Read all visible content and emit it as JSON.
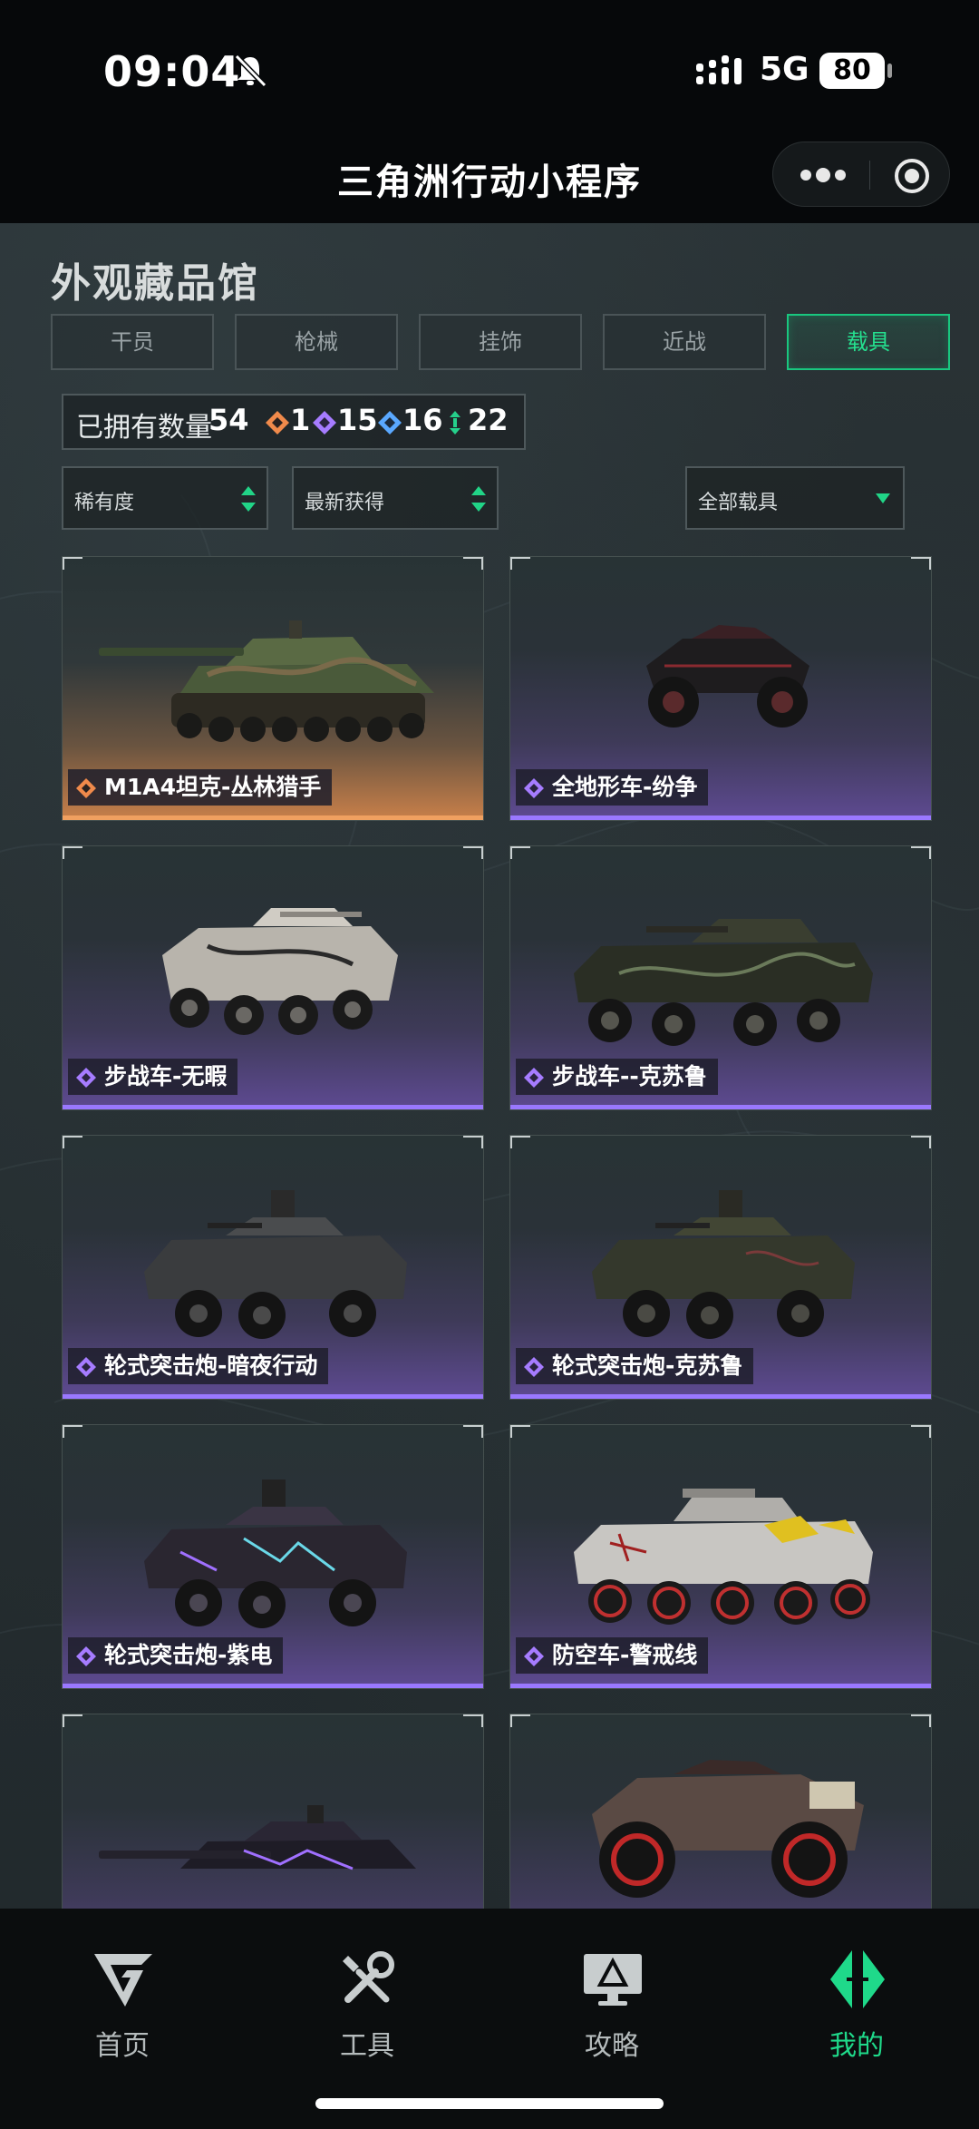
{
  "status_bar": {
    "time": "09:04",
    "network": "5G",
    "battery": "80"
  },
  "title_bar": {
    "title": "三角洲行动小程序"
  },
  "header": {
    "section_title": "外观藏品馆"
  },
  "tabs": [
    {
      "label": "干员",
      "active": false
    },
    {
      "label": "枪械",
      "active": false
    },
    {
      "label": "挂饰",
      "active": false
    },
    {
      "label": "近战",
      "active": false
    },
    {
      "label": "载具",
      "active": true
    }
  ],
  "owned": {
    "label": "已拥有数量",
    "count": "54",
    "stats": [
      {
        "value": "1",
        "color": "#f08a4b",
        "icon": "orange-diamond-icon"
      },
      {
        "value": "15",
        "color": "#a67cff",
        "icon": "purple-diamond-icon"
      },
      {
        "value": "16",
        "color": "#5aa8ff",
        "icon": "blue-diamond-icon"
      },
      {
        "value": "22",
        "color": "#25d08b",
        "icon": "green-diamond-icon"
      }
    ]
  },
  "filters": {
    "rarity": "稀有度",
    "sort": "最新获得",
    "category": "全部载具"
  },
  "cards": [
    {
      "name": "M1A4坦克-丛林猎手",
      "rarity": "orange"
    },
    {
      "name": "全地形车-纷争",
      "rarity": "purple"
    },
    {
      "name": "步战车-无暇",
      "rarity": "purple"
    },
    {
      "name": "步战车--克苏鲁",
      "rarity": "purple"
    },
    {
      "name": "轮式突击炮-暗夜行动",
      "rarity": "purple"
    },
    {
      "name": "轮式突击炮-克苏鲁",
      "rarity": "purple"
    },
    {
      "name": "轮式突击炮-紫电",
      "rarity": "purple"
    },
    {
      "name": "防空车-警戒线",
      "rarity": "purple"
    },
    {
      "name": "",
      "rarity": "purple"
    },
    {
      "name": "",
      "rarity": "purple"
    }
  ],
  "nav": [
    {
      "label": "首页",
      "icon": "home-logo-icon",
      "active": false
    },
    {
      "label": "工具",
      "icon": "tools-icon",
      "active": false
    },
    {
      "label": "攻略",
      "icon": "guide-monitor-icon",
      "active": false
    },
    {
      "label": "我的",
      "icon": "profile-logo-icon",
      "active": true
    }
  ],
  "colors": {
    "accent": "#1fd98a",
    "purple": "#9a78ff",
    "orange": "#f0a060"
  }
}
